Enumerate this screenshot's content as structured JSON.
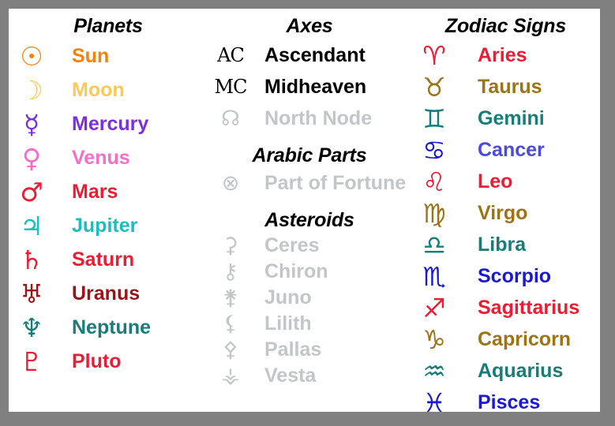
{
  "panel": {
    "background_color": "#ffffff",
    "border_color": "#808080"
  },
  "columns": [
    {
      "id": "planets",
      "title": "Planets",
      "items": [
        {
          "name": "Sun",
          "glyph": "☉",
          "icon": "sun-symbol-icon",
          "color": "#F5820B"
        },
        {
          "name": "Moon",
          "glyph": "☽",
          "icon": "moon-symbol-icon",
          "color": "#FFC857"
        },
        {
          "name": "Mercury",
          "glyph": "☿",
          "icon": "mercury-symbol-icon",
          "color": "#7B2FE0"
        },
        {
          "name": "Venus",
          "glyph": "♀",
          "icon": "venus-symbol-icon",
          "color": "#F56EC8"
        },
        {
          "name": "Mars",
          "glyph": "♂",
          "icon": "mars-symbol-icon",
          "color": "#ED1C33"
        },
        {
          "name": "Jupiter",
          "glyph": "♃",
          "icon": "jupiter-symbol-icon",
          "color": "#19BFBF"
        },
        {
          "name": "Saturn",
          "glyph": "♄",
          "icon": "saturn-symbol-icon",
          "color": "#ED1C33"
        },
        {
          "name": "Uranus",
          "glyph": "♅",
          "icon": "uranus-symbol-icon",
          "color": "#9B1419"
        },
        {
          "name": "Neptune",
          "glyph": "♆",
          "icon": "neptune-symbol-icon",
          "color": "#187D78"
        },
        {
          "name": "Pluto",
          "glyph": "♇",
          "icon": "pluto-symbol-icon",
          "color": "#ED1C33"
        }
      ]
    },
    {
      "id": "middle",
      "groups": [
        {
          "title": "Axes",
          "items": [
            {
              "name": "Ascendant",
              "glyph": "AC",
              "icon": "ascendant-abbrev-icon",
              "color": "#000000",
              "glyph_color": "#000000"
            },
            {
              "name": "Midheaven",
              "glyph": "MC",
              "icon": "midheaven-abbrev-icon",
              "color": "#000000",
              "glyph_color": "#000000"
            },
            {
              "name": "North Node",
              "glyph": "☊",
              "icon": "north-node-symbol-icon",
              "color": "#C3C6C9",
              "glyph_color": "#C3C6C9"
            }
          ]
        },
        {
          "title": "Arabic Parts",
          "items": [
            {
              "name": "Part of Fortune",
              "glyph": "⊗",
              "icon": "part-of-fortune-symbol-icon",
              "color": "#C3C6C9",
              "glyph_color": "#C3C6C9"
            }
          ]
        },
        {
          "title": "Asteroids",
          "items": [
            {
              "name": "Ceres",
              "glyph": "⚳",
              "icon": "ceres-symbol-icon",
              "color": "#C3C6C9",
              "glyph_color": "#C3C6C9"
            },
            {
              "name": "Chiron",
              "glyph": "⚷",
              "icon": "chiron-symbol-icon",
              "color": "#C3C6C9",
              "glyph_color": "#C3C6C9"
            },
            {
              "name": "Juno",
              "glyph": "⚵",
              "icon": "juno-symbol-icon",
              "color": "#C3C6C9",
              "glyph_color": "#C3C6C9"
            },
            {
              "name": "Lilith",
              "glyph": "⚸",
              "icon": "lilith-symbol-icon",
              "color": "#C3C6C9",
              "glyph_color": "#C3C6C9"
            },
            {
              "name": "Pallas",
              "glyph": "⚴",
              "icon": "pallas-symbol-icon",
              "color": "#C3C6C9",
              "glyph_color": "#C3C6C9"
            },
            {
              "name": "Vesta",
              "glyph": "⚶",
              "icon": "vesta-symbol-icon",
              "color": "#C3C6C9",
              "glyph_color": "#C3C6C9"
            }
          ]
        }
      ]
    },
    {
      "id": "zodiac",
      "title": "Zodiac Signs",
      "items": [
        {
          "name": "Aries",
          "glyph": "♈",
          "icon": "aries-symbol-icon",
          "color": "#ED1C33",
          "glyph_color": "#ED1C33"
        },
        {
          "name": "Taurus",
          "glyph": "♉",
          "icon": "taurus-symbol-icon",
          "color": "#9C7318",
          "glyph_color": "#9C7318"
        },
        {
          "name": "Gemini",
          "glyph": "♊",
          "icon": "gemini-symbol-icon",
          "color": "#187D78",
          "glyph_color": "#187D78"
        },
        {
          "name": "Cancer",
          "glyph": "♋",
          "icon": "cancer-symbol-icon",
          "color": "#4A4ADB",
          "glyph_color": "#1919D6"
        },
        {
          "name": "Leo",
          "glyph": "♌",
          "icon": "leo-symbol-icon",
          "color": "#ED1C33",
          "glyph_color": "#ED1C33"
        },
        {
          "name": "Virgo",
          "glyph": "♍",
          "icon": "virgo-symbol-icon",
          "color": "#9C7318",
          "glyph_color": "#9C7318"
        },
        {
          "name": "Libra",
          "glyph": "♎",
          "icon": "libra-symbol-icon",
          "color": "#187D78",
          "glyph_color": "#187D78"
        },
        {
          "name": "Scorpio",
          "glyph": "♏",
          "icon": "scorpio-symbol-icon",
          "color": "#1919D6",
          "glyph_color": "#1919D6"
        },
        {
          "name": "Sagittarius",
          "glyph": "♐",
          "icon": "sagittarius-symbol-icon",
          "color": "#ED1C33",
          "glyph_color": "#ED1C33"
        },
        {
          "name": "Capricorn",
          "glyph": "♑",
          "icon": "capricorn-symbol-icon",
          "color": "#9C7318",
          "glyph_color": "#9C7318"
        },
        {
          "name": "Aquarius",
          "glyph": "♒",
          "icon": "aquarius-symbol-icon",
          "color": "#187D78",
          "glyph_color": "#187D78"
        },
        {
          "name": "Pisces",
          "glyph": "♓",
          "icon": "pisces-symbol-icon",
          "color": "#1919D6",
          "glyph_color": "#1919D6"
        }
      ]
    }
  ]
}
